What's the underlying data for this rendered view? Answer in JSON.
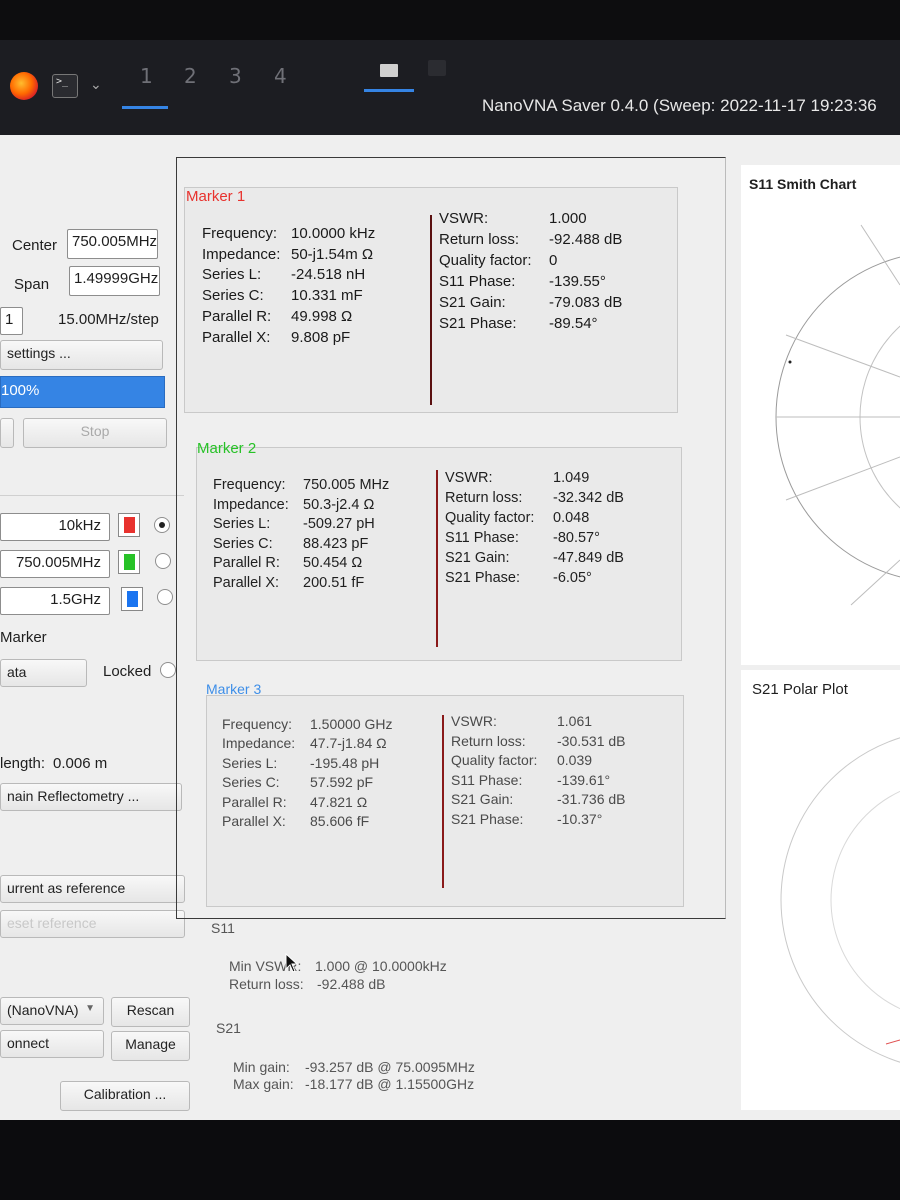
{
  "taskbar": {
    "workspaces": [
      "1",
      "2",
      "3",
      "4"
    ],
    "window_title": "NanoVNA Saver 0.4.0 (Sweep: 2022-11-17 19:23:36"
  },
  "sweep": {
    "center_label": "Center",
    "center_value": "750.005MHz",
    "span_label": "Span",
    "span_value": "1.49999GHz",
    "segments_value": "1",
    "step_text": "15.00MHz/step",
    "settings_button": "settings ...",
    "progress_text": "100%",
    "stop_button": "Stop"
  },
  "marker_controls": {
    "rows": [
      {
        "value": "10kHz",
        "color": "#e8322e",
        "selected": true
      },
      {
        "value": "750.005MHz",
        "color": "#27c227",
        "selected": false
      },
      {
        "value": "1.5GHz",
        "color": "#1a74f0",
        "selected": false
      }
    ],
    "marker_label": "Marker",
    "data_field": "ata",
    "locked_label": "Locked"
  },
  "tdr": {
    "length_label": "length:",
    "length_value": "0.006 m",
    "reflectometry_button": "nain Reflectometry ..."
  },
  "reference": {
    "set_button": "urrent as reference",
    "reset_button": "eset reference"
  },
  "device": {
    "select_value": "(NanoVNA)",
    "rescan_button": "Rescan",
    "connect_button": "onnect",
    "manage_button": "Manage",
    "calibration_button": "Calibration ..."
  },
  "markers": [
    {
      "title": "Marker 1",
      "title_color": "#e8322e",
      "divider_color": "#5a1010",
      "left": [
        {
          "k": "Frequency:",
          "v": "10.0000 kHz"
        },
        {
          "k": "Impedance:",
          "v": "50-j1.54m Ω"
        },
        {
          "k": "Series L:",
          "v": "-24.518 nH"
        },
        {
          "k": "Series C:",
          "v": "10.331 mF"
        },
        {
          "k": "Parallel R:",
          "v": "49.998 Ω"
        },
        {
          "k": "Parallel X:",
          "v": "9.808 pF"
        }
      ],
      "right": [
        {
          "k": "VSWR:",
          "v": "1.000"
        },
        {
          "k": "Return loss:",
          "v": "-92.488 dB"
        },
        {
          "k": "Quality factor:",
          "v": "0"
        },
        {
          "k": "S11 Phase:",
          "v": "-139.55°"
        },
        {
          "k": "S21 Gain:",
          "v": "-79.083 dB"
        },
        {
          "k": "S21 Phase:",
          "v": "-89.54°"
        }
      ]
    },
    {
      "title": "Marker 2",
      "title_color": "#27c227",
      "divider_color": "#8a1a1a",
      "left": [
        {
          "k": "Frequency:",
          "v": "750.005 MHz"
        },
        {
          "k": "Impedance:",
          "v": "50.3-j2.4 Ω"
        },
        {
          "k": "Series L:",
          "v": "-509.27 pH"
        },
        {
          "k": "Series C:",
          "v": "88.423 pF"
        },
        {
          "k": "Parallel R:",
          "v": "50.454 Ω"
        },
        {
          "k": "Parallel X:",
          "v": "200.51 fF"
        }
      ],
      "right": [
        {
          "k": "VSWR:",
          "v": "1.049"
        },
        {
          "k": "Return loss:",
          "v": "-32.342 dB"
        },
        {
          "k": "Quality factor:",
          "v": "0.048"
        },
        {
          "k": "S11 Phase:",
          "v": "-80.57°"
        },
        {
          "k": "S21 Gain:",
          "v": "-47.849 dB"
        },
        {
          "k": "S21 Phase:",
          "v": "-6.05°"
        }
      ]
    },
    {
      "title": "Marker 3",
      "title_color": "#3d8ee8",
      "divider_color": "#8a1a1a",
      "left": [
        {
          "k": "Frequency:",
          "v": "1.50000 GHz"
        },
        {
          "k": "Impedance:",
          "v": "47.7-j1.84 Ω"
        },
        {
          "k": "Series L:",
          "v": "-195.48 pH"
        },
        {
          "k": "Series C:",
          "v": "57.592 pF"
        },
        {
          "k": "Parallel R:",
          "v": "47.821 Ω"
        },
        {
          "k": "Parallel X:",
          "v": "85.606 fF"
        }
      ],
      "right": [
        {
          "k": "VSWR:",
          "v": "1.061"
        },
        {
          "k": "Return loss:",
          "v": "-30.531 dB"
        },
        {
          "k": "Quality factor:",
          "v": "0.039"
        },
        {
          "k": "S11 Phase:",
          "v": "-139.61°"
        },
        {
          "k": "S21 Gain:",
          "v": "-31.736 dB"
        },
        {
          "k": "S21 Phase:",
          "v": "-10.37°"
        }
      ]
    }
  ],
  "summary": {
    "s11_title": "S11",
    "min_vswr_label": "Min VSWR:",
    "min_vswr_value": "1.000 @ 10.0000kHz",
    "return_loss_label": "Return loss:",
    "return_loss_value": "-92.488 dB",
    "s21_title": "S21",
    "min_gain_label": "Min gain:",
    "min_gain_value": "-93.257 dB @ 75.0095MHz",
    "max_gain_label": "Max gain:",
    "max_gain_value": "-18.177 dB @ 1.15500GHz"
  },
  "charts": {
    "smith_title": "S11 Smith Chart",
    "polar_title": "S21 Polar Plot"
  }
}
